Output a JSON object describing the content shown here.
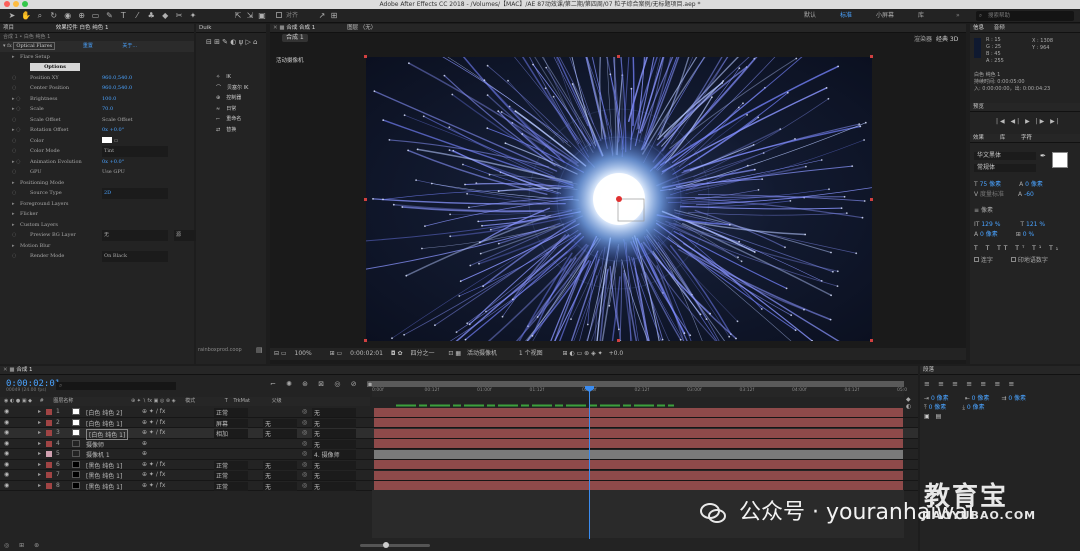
{
  "app": {
    "title": "Adobe After Effects CC 2018 - /Volumes/【MAC】/AE 87动效课/第二期/第四周/07 粒子综合案例/无标题项目.aep *"
  },
  "workspace": {
    "default": "默认",
    "standard": "标准",
    "small": "小屏幕",
    "library": "库",
    "search_placeholder": "搜索帮助",
    "align": "对齐"
  },
  "project_panel": {
    "tab": "项目",
    "effect_tab": "效果控件 白色 纯色 1",
    "breadcrumb": "合成 1 • 白色 纯色 1"
  },
  "effects": {
    "fx_name": "Optical Flares",
    "reset": "重置",
    "about": "关于...",
    "rows": [
      {
        "label": "Flare Setup",
        "value": ""
      },
      {
        "label": "Position XY",
        "value": "960.0,540.0"
      },
      {
        "label": "Center Position",
        "value": "960.0,540.0"
      },
      {
        "label": "Brightness",
        "value": "100.0"
      },
      {
        "label": "Scale",
        "value": "70.0"
      },
      {
        "label": "Scale Offset",
        "value": "Scale Offset"
      },
      {
        "label": "Rotation Offset",
        "value": "0x +0.0°"
      },
      {
        "label": "Color",
        "value": ""
      },
      {
        "label": "Color Mode",
        "value": "Tint"
      },
      {
        "label": "Animation Evolution",
        "value": "0x +0.0°"
      },
      {
        "label": "GPU",
        "value": "Use GPU"
      },
      {
        "label": "Positioning Mode",
        "value": ""
      },
      {
        "label": "Source Type",
        "value": "2D"
      },
      {
        "label": "Foreground Layers",
        "value": ""
      },
      {
        "label": "Flicker",
        "value": ""
      },
      {
        "label": "Custom Layers",
        "value": ""
      },
      {
        "label": "Preview BG Layer",
        "value": "无"
      },
      {
        "label": "Motion Blur",
        "value": ""
      },
      {
        "label": "Render Mode",
        "value": "On Black"
      }
    ],
    "options_button": "Options",
    "preview_bg_source": "源"
  },
  "duik": {
    "tab": "Duik",
    "items": [
      "IK",
      "贝塞尔 IK",
      "控制器",
      "日常",
      "重命名",
      "替换"
    ],
    "bottom": "rainboxprod.coop"
  },
  "comp_panel": {
    "tab": "合成 合成 1",
    "layer_tab": "图层 （无）",
    "breadcrumb": "合成 1",
    "camera_label": "活动摄像机",
    "renderer": "渲染器",
    "classic3d": "经典 3D"
  },
  "viewer_footer": {
    "zoom": "100%",
    "time": "0:00:02:01",
    "resolution": "四分之一",
    "camera": "活动摄像机",
    "views": "1 个视图",
    "offset": "+0.0"
  },
  "info": {
    "tab": "信息",
    "audio_tab": "音频",
    "r": "R : 15",
    "g": "G : 25",
    "b": "B : 45",
    "a": "A : 255",
    "x": "X : 1308",
    "y": "Y : 964",
    "layer": "白色 纯色 1",
    "duration": "持续时间: 0:00:05:00",
    "in_out": "入: 0:00:00:00，出: 0:00:04:23"
  },
  "preview": {
    "tab": "预览"
  },
  "character": {
    "tab_effects": "效果",
    "tab_lib": "库",
    "tab_char": "字符",
    "font": "华文黑体",
    "style": "常规体",
    "size": "75 像素",
    "tracking_auto": "度量标准",
    "leading": "0 像素",
    "tracking": "-60",
    "stroke_unit": "像素",
    "vscale": "129 %",
    "hscale": "121 %",
    "baseline": "0 像素",
    "tsume": "0 %",
    "ligature": "连字",
    "hindi_digits": "印地语数字"
  },
  "paragraph": {
    "tab": "段落",
    "indent": [
      "0 像素",
      "0 像素",
      "0 像素",
      "0 像素",
      "0 像素"
    ]
  },
  "timeline": {
    "tab": "合成 1",
    "timecode": "0:00:02:01",
    "frames": "00049 (24.00 fps)",
    "headers": {
      "num": "#",
      "name": "图层名称",
      "mode": "模式",
      "t": "T",
      "trkmat": "TrkMat",
      "parent": "父级"
    },
    "ruler": [
      "0:00f",
      "00:12f",
      "01:00f",
      "01:12f",
      "02:00f",
      "02:12f",
      "03:00f",
      "03:12f",
      "04:00f",
      "04:12f",
      "05:0"
    ],
    "layers": [
      {
        "num": "1",
        "name": "[白色 纯色 2]",
        "mode": "正常",
        "trkmat": "",
        "parent": "无",
        "color": "#a04444"
      },
      {
        "num": "2",
        "name": "[白色 纯色 1]",
        "mode": "屏幕",
        "trkmat": "无",
        "parent": "无",
        "color": "#a04444"
      },
      {
        "num": "3",
        "name": "[白色 纯色 1]",
        "mode": "相加",
        "trkmat": "无",
        "parent": "无",
        "color": "#a04444"
      },
      {
        "num": "4",
        "name": "摄像师",
        "mode": "",
        "trkmat": "",
        "parent": "无",
        "color": "#a04444"
      },
      {
        "num": "5",
        "name": "摄像机 1",
        "mode": "",
        "trkmat": "",
        "parent": "4. 摄像师",
        "color": "#d0a0b0"
      },
      {
        "num": "6",
        "name": "[黑色 纯色 1]",
        "mode": "正常",
        "trkmat": "无",
        "parent": "无",
        "color": "#a04444"
      },
      {
        "num": "7",
        "name": "[黑色 纯色 1]",
        "mode": "正常",
        "trkmat": "无",
        "parent": "无",
        "color": "#a04444"
      },
      {
        "num": "8",
        "name": "[黑色 纯色 1]",
        "mode": "正常",
        "trkmat": "无",
        "parent": "无",
        "color": "#a04444"
      }
    ]
  },
  "watermark": {
    "wechat": "公众号 · youranhaiwai",
    "site": "JIAOYUBAO.COM",
    "logo": "教育宝"
  }
}
